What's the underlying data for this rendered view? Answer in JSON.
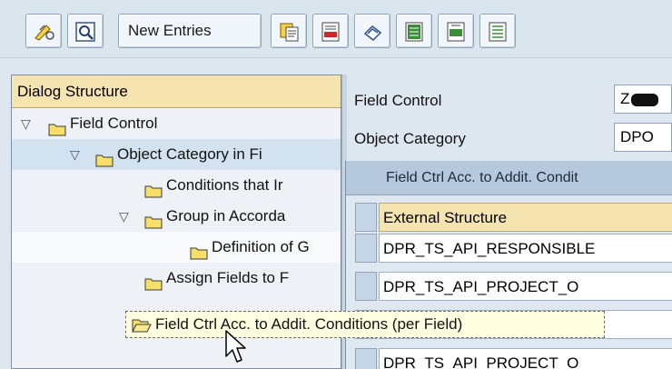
{
  "toolbar": {
    "buttons": [
      {
        "name": "display-change-icon"
      },
      {
        "name": "find-icon"
      },
      {
        "name": "new-entries-button",
        "label": "New Entries"
      },
      {
        "name": "copy-icon"
      },
      {
        "name": "delete-icon"
      },
      {
        "name": "undo-icon"
      },
      {
        "name": "select-all-icon"
      },
      {
        "name": "select-block-icon"
      },
      {
        "name": "deselect-all-icon"
      }
    ]
  },
  "tree": {
    "header": "Dialog Structure",
    "items": [
      {
        "label": "Field Control",
        "level": 0,
        "expanded": true
      },
      {
        "label": "Object Category in Fi",
        "level": 1,
        "expanded": true
      },
      {
        "label": "Conditions that Ir",
        "level": 2
      },
      {
        "label": "Group in Accorda",
        "level": 2,
        "expanded": true
      },
      {
        "label": "Definition of G",
        "level": 3
      },
      {
        "label": "Assign Fields to F",
        "level": 2
      }
    ]
  },
  "form": {
    "field_control_label": "Field Control",
    "field_control_value": "Z",
    "object_category_label": "Object Category",
    "object_category_value": "DPO"
  },
  "grid": {
    "title": "Field Ctrl Acc. to Addit. Condit",
    "column_header": "External Structure",
    "rows": [
      "DPR_TS_API_RESPONSIBLE",
      "DPR_TS_API_PROJECT_O",
      "DPR_TS_API_PROJECT_O",
      "DPR_TS_API_PROJECT_O"
    ]
  },
  "tooltip": {
    "text": "Field Ctrl Acc. to Addit. Conditions (per Field)"
  },
  "colors": {
    "header_bg": "#f5e4b0",
    "panel_bg": "#dee7ef",
    "grid_title_bg": "#b6c9dc"
  }
}
